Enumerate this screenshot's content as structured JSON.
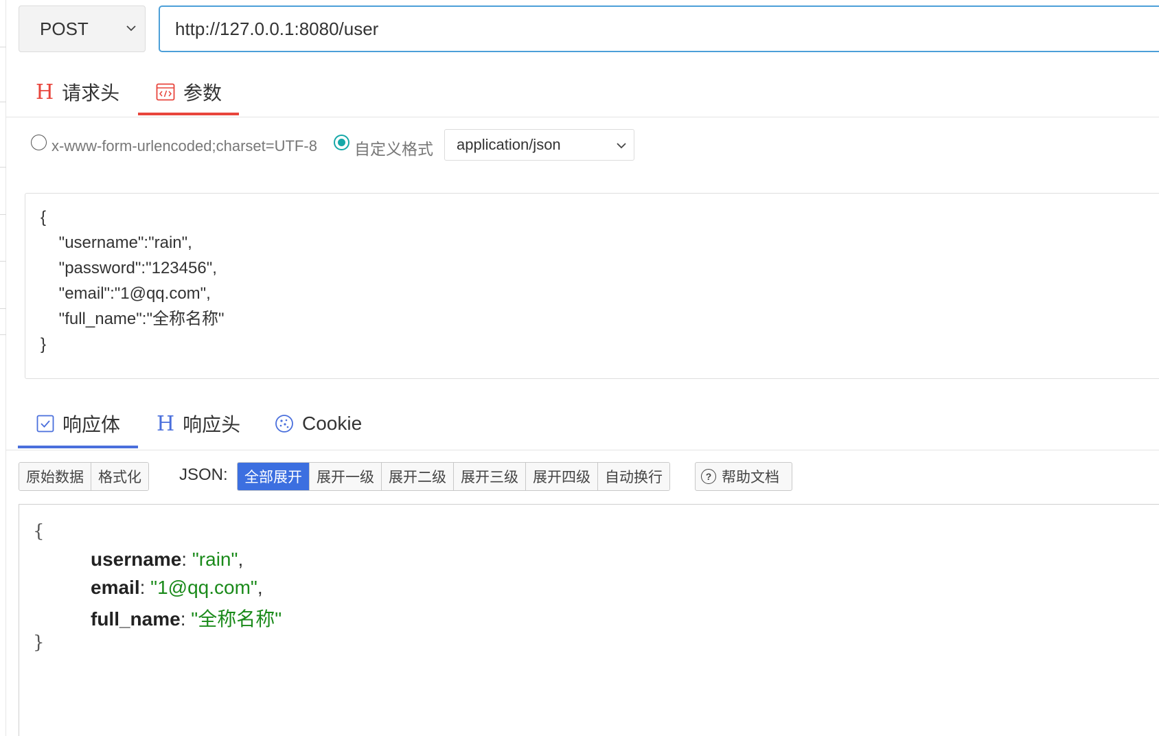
{
  "request": {
    "method": "POST",
    "url": "http://127.0.0.1:8080/user"
  },
  "request_tabs": [
    {
      "label": "请求头",
      "icon": "h-header-icon",
      "active": false
    },
    {
      "label": "参数",
      "icon": "code-window-icon",
      "active": true
    }
  ],
  "params": {
    "urlencoded_label": "x-www-form-urlencoded;charset=UTF-8",
    "custom_label": "自定义格式",
    "selected_format": "custom",
    "content_type": "application/json"
  },
  "request_body": {
    "lines": [
      "{",
      "    \"username\":\"rain\",",
      "    \"password\":\"123456\",",
      "    \"email\":\"1@qq.com\",",
      "    \"full_name\":\"全称名称\"",
      "}"
    ]
  },
  "response_tabs": [
    {
      "label": "响应体",
      "icon": "checkbox-icon",
      "active": true
    },
    {
      "label": "响应头",
      "icon": "h-header-icon",
      "active": false
    },
    {
      "label": "Cookie",
      "icon": "cookie-icon",
      "active": false
    }
  ],
  "toolbar": {
    "view_modes": [
      "原始数据",
      "格式化"
    ],
    "json_label": "JSON:",
    "json_actions": [
      "全部展开",
      "展开一级",
      "展开二级",
      "展开三级",
      "展开四级",
      "自动换行"
    ],
    "active_action": "全部展开",
    "help_label": "帮助文档"
  },
  "response_body": {
    "open_brace": "{",
    "close_brace": "}",
    "entries": [
      {
        "key": "username",
        "value": "\"rain\"",
        "sep": ","
      },
      {
        "key": "email",
        "value": "\"1@qq.com\"",
        "sep": ","
      },
      {
        "key": "full_name",
        "value": "\"全称名称\"",
        "sep": ""
      }
    ]
  },
  "colors": {
    "url_border": "#4c9fd8",
    "request_tab_accent": "#e8453c",
    "response_tab_accent": "#4a6fdc",
    "active_button": "#3c6fe0",
    "radio_on": "#16a8a8",
    "json_string": "#1a8a1a"
  }
}
